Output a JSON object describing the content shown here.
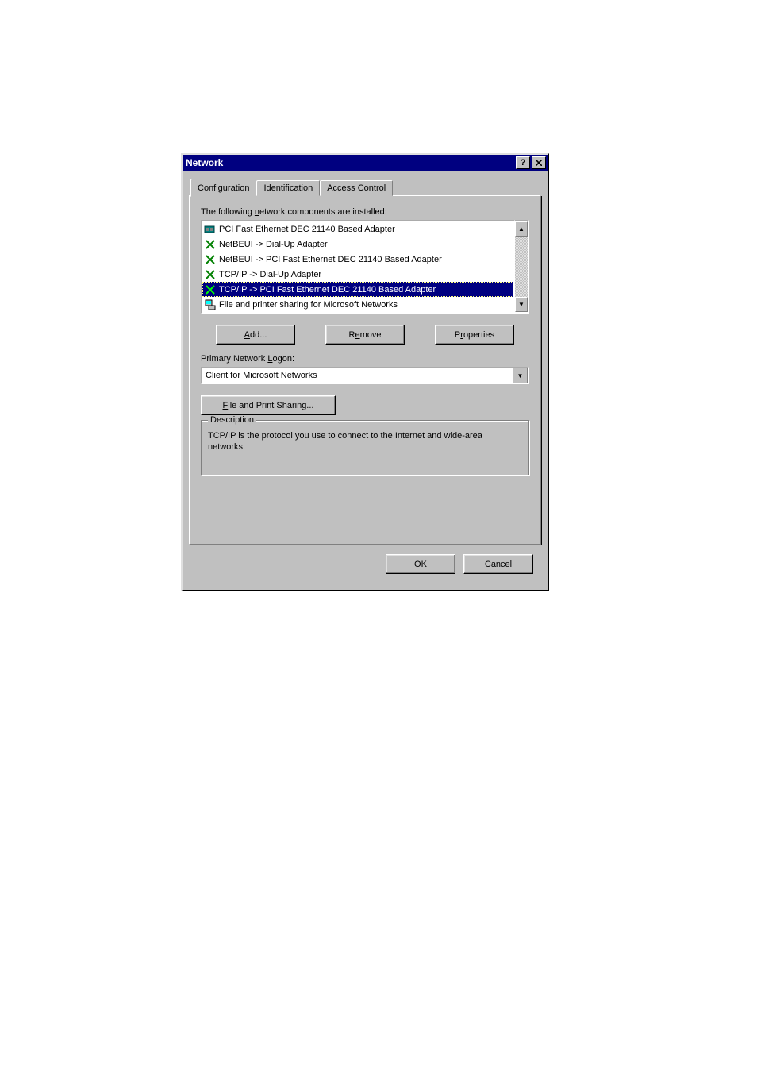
{
  "title": "Network",
  "tabs": {
    "t0": "Configuration",
    "t1": "Identification",
    "t2": "Access Control"
  },
  "list_label_pre": "The following ",
  "list_label_u": "n",
  "list_label_post": "etwork components are installed:",
  "items": {
    "i0": "PCI Fast Ethernet DEC 21140 Based Adapter",
    "i1": "NetBEUI -> Dial-Up Adapter",
    "i2": "NetBEUI -> PCI Fast Ethernet DEC 21140 Based Adapter",
    "i3": "TCP/IP -> Dial-Up Adapter",
    "i4": "TCP/IP -> PCI Fast Ethernet DEC 21140 Based Adapter",
    "i5": "File and printer sharing for Microsoft Networks"
  },
  "buttons": {
    "add_u": "A",
    "add_rest": "dd...",
    "remove_pre": "R",
    "remove_u": "e",
    "remove_post": "move",
    "props_pre": "P",
    "props_u": "r",
    "props_post": "operties",
    "fps_u": "F",
    "fps_rest": "ile and Print Sharing...",
    "ok": "OK",
    "cancel": "Cancel"
  },
  "logon_label_pre": "Primary Network ",
  "logon_label_u": "L",
  "logon_label_post": "ogon:",
  "logon_value": "Client for Microsoft Networks",
  "desc_legend": "Description",
  "desc_text": "TCP/IP is the protocol you use to connect to the Internet and wide-area networks."
}
